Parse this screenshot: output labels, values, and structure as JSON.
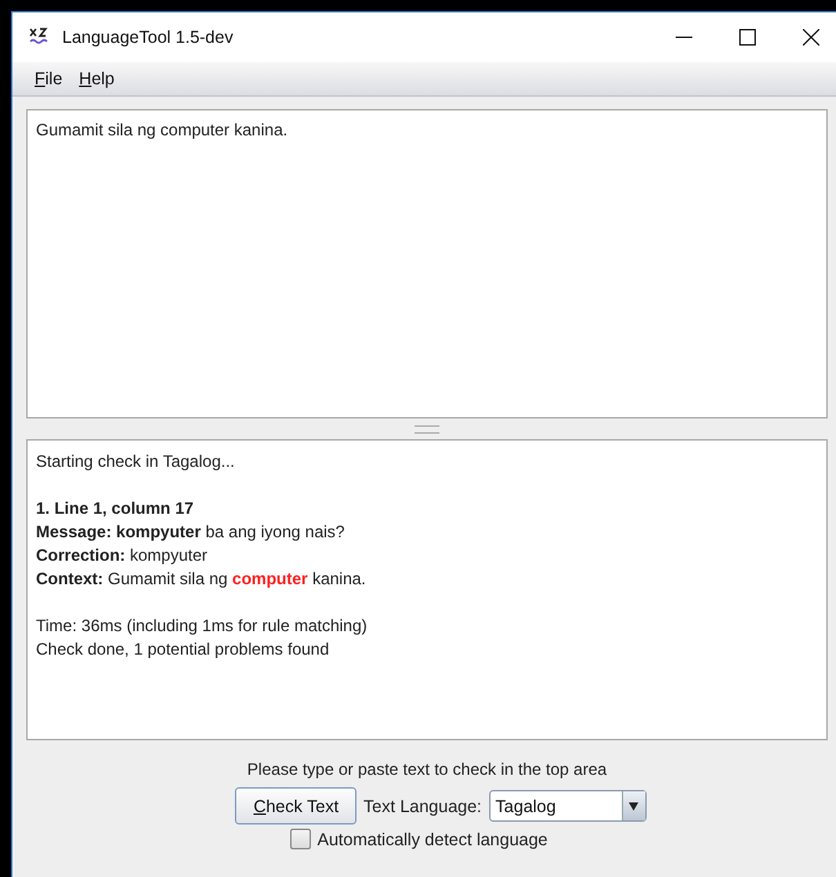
{
  "window": {
    "title": "LanguageTool 1.5-dev"
  },
  "menu": [
    {
      "label": "File"
    },
    {
      "label": "Help"
    }
  ],
  "input_text": "Gumamit sila ng computer kanina.",
  "output": [
    {
      "kind": "plain",
      "text": "Starting check in Tagalog..."
    },
    {
      "kind": "blank"
    },
    {
      "kind": "plain",
      "text": "**1. Line 1, column 17**"
    },
    {
      "kind": "plain",
      "text": "**Message: kompyuter** ba ang iyong nais?"
    },
    {
      "kind": "plain",
      "text": "**Correction:** kompyuter"
    },
    {
      "kind": "context",
      "label": "Context:",
      "before": "Gumamit sila ng",
      "error": "computer",
      "after": "kanina."
    },
    {
      "kind": "blank"
    },
    {
      "kind": "plain",
      "text": "Time: 36ms (including 1ms for rule matching)"
    },
    {
      "kind": "plain",
      "text": "Check done, 1 potential problems found"
    }
  ],
  "hint": "Please type or paste text to check in the top area",
  "check_button": "Check Text",
  "language_label": "Text Language:",
  "language": "Tagalog",
  "auto_detect": {
    "label": "Automatically detect language",
    "checked": false
  }
}
